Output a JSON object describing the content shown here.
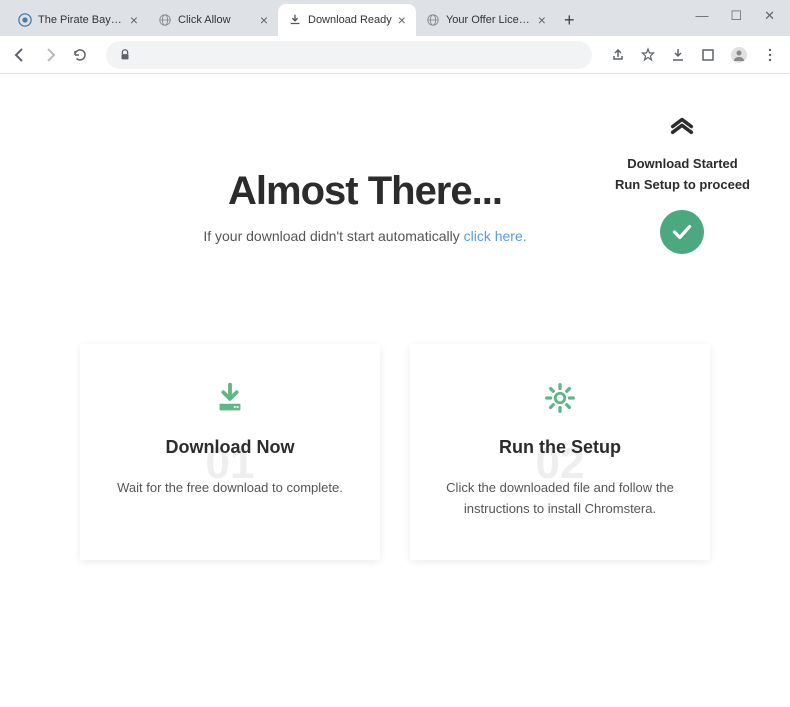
{
  "window": {
    "minimize": "—",
    "maximize": "☐",
    "close": "✕"
  },
  "tabs": [
    {
      "title": "The Pirate Bay - The g",
      "active": false,
      "favicon": "pirate"
    },
    {
      "title": "Click Allow",
      "active": false,
      "favicon": "globe"
    },
    {
      "title": "Download Ready",
      "active": true,
      "favicon": "download"
    },
    {
      "title": "Your Offer License m",
      "active": false,
      "favicon": "globe"
    }
  ],
  "notice": {
    "line1": "Download Started",
    "line2": "Run Setup to proceed"
  },
  "hero": {
    "title": "Almost There...",
    "subtitle_text": "If your download didn't start automatically ",
    "subtitle_link": "click here."
  },
  "cards": {
    "card1": {
      "number": "01",
      "title": "Download Now",
      "desc": "Wait for the free download to complete."
    },
    "card2": {
      "number": "02",
      "title": "Run the Setup",
      "desc": "Click the downloaded file and follow the instructions to install Chromstera."
    }
  }
}
